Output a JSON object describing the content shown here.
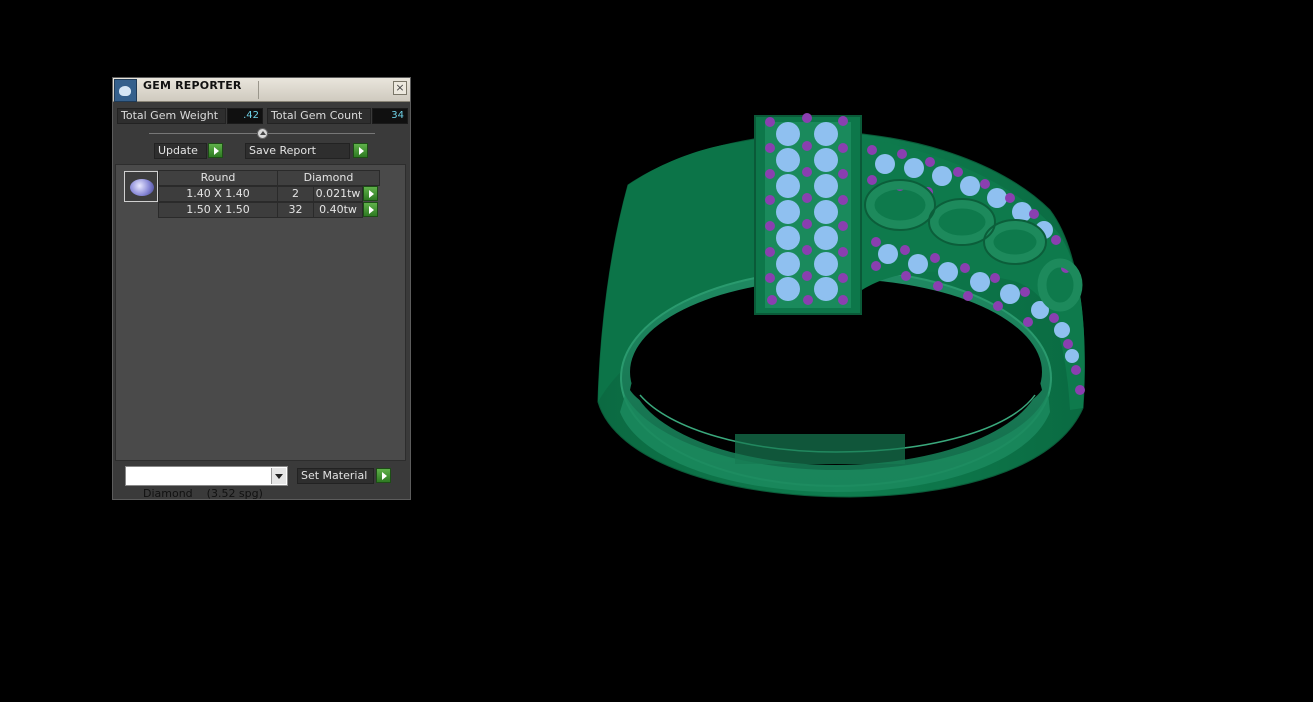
{
  "panel": {
    "title": "GEM REPORTER",
    "close_label": "×",
    "total_weight_label": "Total Gem Weight",
    "total_weight_value": ".42",
    "total_count_label": "Total Gem Count",
    "total_count_value": "34",
    "update_label": "Update",
    "save_report_label": "Save Report"
  },
  "gem_table": {
    "headers": [
      "Round",
      "Diamond"
    ],
    "rows": [
      {
        "size": "1.40 X 1.40",
        "count": "2",
        "weight": "0.021tw"
      },
      {
        "size": "1.50 X 1.50",
        "count": "32",
        "weight": "0.40tw"
      }
    ]
  },
  "material": {
    "selected": "Diamond    (3.52 spg)",
    "set_label": "Set Material"
  },
  "colors": {
    "metal": "#0f7a4e",
    "stone": "#8fc0f0",
    "prong": "#8a3fb0",
    "value_text": "#6fd3e8",
    "go_button": "#3f9a2e"
  }
}
